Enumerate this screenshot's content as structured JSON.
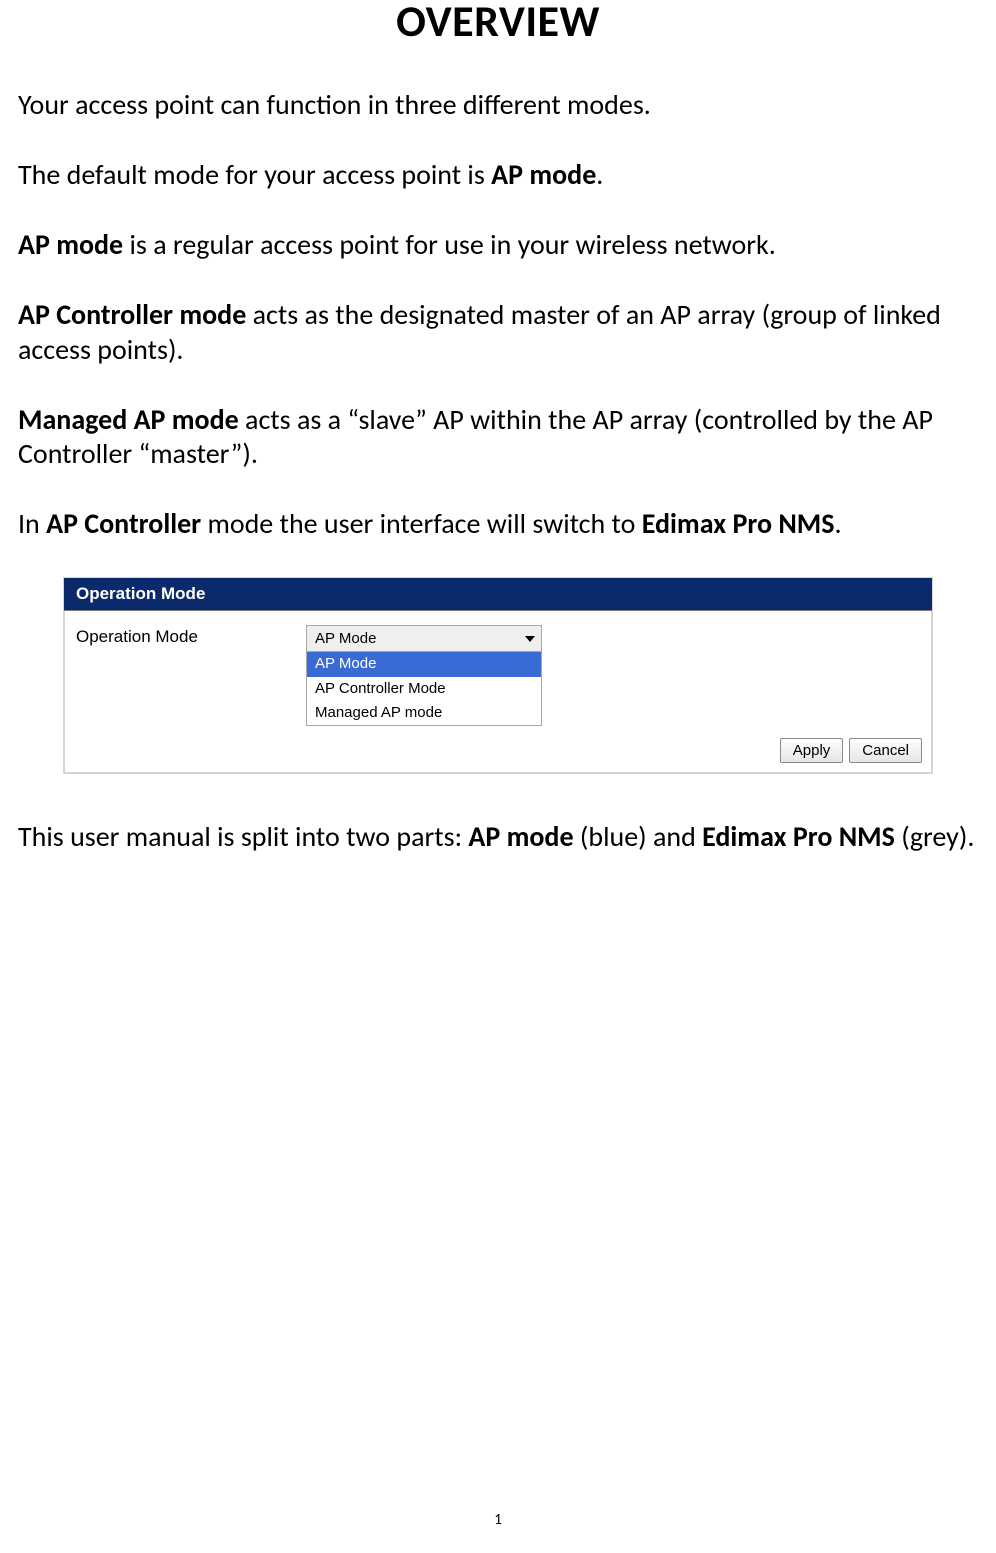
{
  "title": "OVERVIEW",
  "para1": {
    "t1": "Your access point can function in three different modes."
  },
  "para2": {
    "t1": "The default mode for your access point is ",
    "b1": "AP mode",
    "t2": "."
  },
  "para3": {
    "b1": "AP mode",
    "t1": " is a regular access point for use in your wireless network."
  },
  "para4": {
    "b1": "AP Controller mode",
    "t1": " acts as the designated master of an AP array (group of linked access points)."
  },
  "para5": {
    "b1": "Managed AP mode",
    "t1": " acts as a “slave” AP within the AP array (controlled by the AP Controller “master”)."
  },
  "para6": {
    "t1": "In ",
    "b1": "AP Controller",
    "t2": " mode the user interface will switch to ",
    "b2": "Edimax Pro NMS",
    "t3": "."
  },
  "figure": {
    "panel_title": "Operation Mode",
    "field_label": "Operation Mode",
    "selected_display": "AP Mode",
    "options": {
      "o0": "AP Mode",
      "o1": "AP Controller Mode",
      "o2": "Managed AP mode"
    },
    "apply_label": "Apply",
    "cancel_label": "Cancel"
  },
  "para7": {
    "t1": "This user manual is split into two parts: ",
    "b1": "AP mode",
    "t2": " (blue) and ",
    "b2": "Edimax Pro NMS",
    "t3": " (grey)."
  },
  "page_number": "1"
}
